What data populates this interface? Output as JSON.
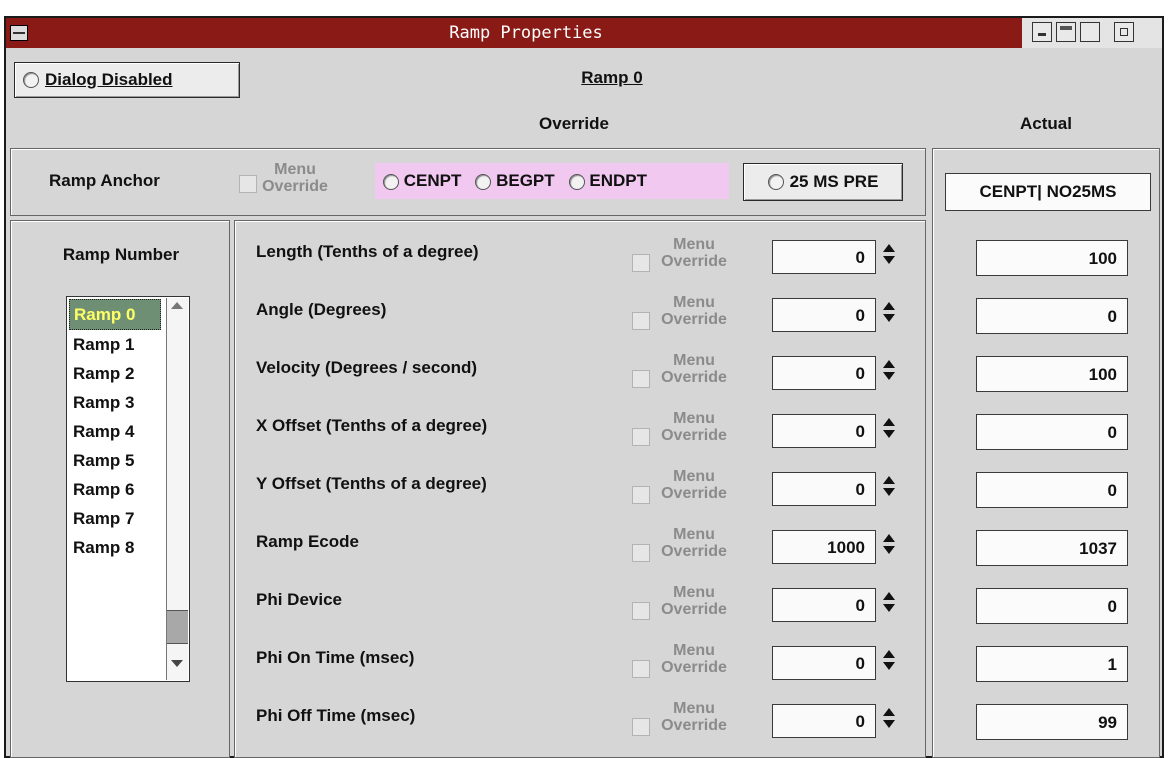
{
  "window": {
    "title": "Ramp Properties"
  },
  "header": {
    "dialog_disabled_label": "Dialog Disabled",
    "ramp_title": "Ramp 0",
    "override_label": "Override",
    "actual_label": "Actual"
  },
  "anchor": {
    "label": "Ramp Anchor",
    "menu_override_line1": "Menu",
    "menu_override_line2": "Override",
    "options": [
      "CENPT",
      "BEGPT",
      "ENDPT"
    ],
    "pre_button": "25 MS PRE",
    "actual_value": "CENPT| NO25MS",
    "highlight_color": "#f0c8f0"
  },
  "ramp_number": {
    "label": "Ramp Number",
    "items": [
      "Ramp 0",
      "Ramp 1",
      "Ramp 2",
      "Ramp 3",
      "Ramp 4",
      "Ramp 5",
      "Ramp 6",
      "Ramp 7",
      "Ramp 8"
    ],
    "selected": "Ramp 0",
    "selected_bg": "#6f8f74",
    "selected_fg": "#ffff66"
  },
  "params": {
    "menu_override_line1": "Menu",
    "menu_override_line2": "Override",
    "rows": [
      {
        "label": "Length (Tenths of a degree)",
        "override": "0",
        "actual": "100"
      },
      {
        "label": "Angle (Degrees)",
        "override": "0",
        "actual": "0"
      },
      {
        "label": "Velocity (Degrees / second)",
        "override": "0",
        "actual": "100"
      },
      {
        "label": "X Offset (Tenths of a degree)",
        "override": "0",
        "actual": "0"
      },
      {
        "label": "Y Offset (Tenths of a degree)",
        "override": "0",
        "actual": "0"
      },
      {
        "label": "Ramp Ecode",
        "override": "1000",
        "actual": "1037"
      },
      {
        "label": "Phi Device",
        "override": "0",
        "actual": "0"
      },
      {
        "label": "Phi On Time (msec)",
        "override": "0",
        "actual": "1"
      },
      {
        "label": "Phi Off Time (msec)",
        "override": "0",
        "actual": "99"
      }
    ]
  },
  "colors": {
    "titlebar": "#8a1a16",
    "dialog_bg": "#d6d6d6"
  }
}
